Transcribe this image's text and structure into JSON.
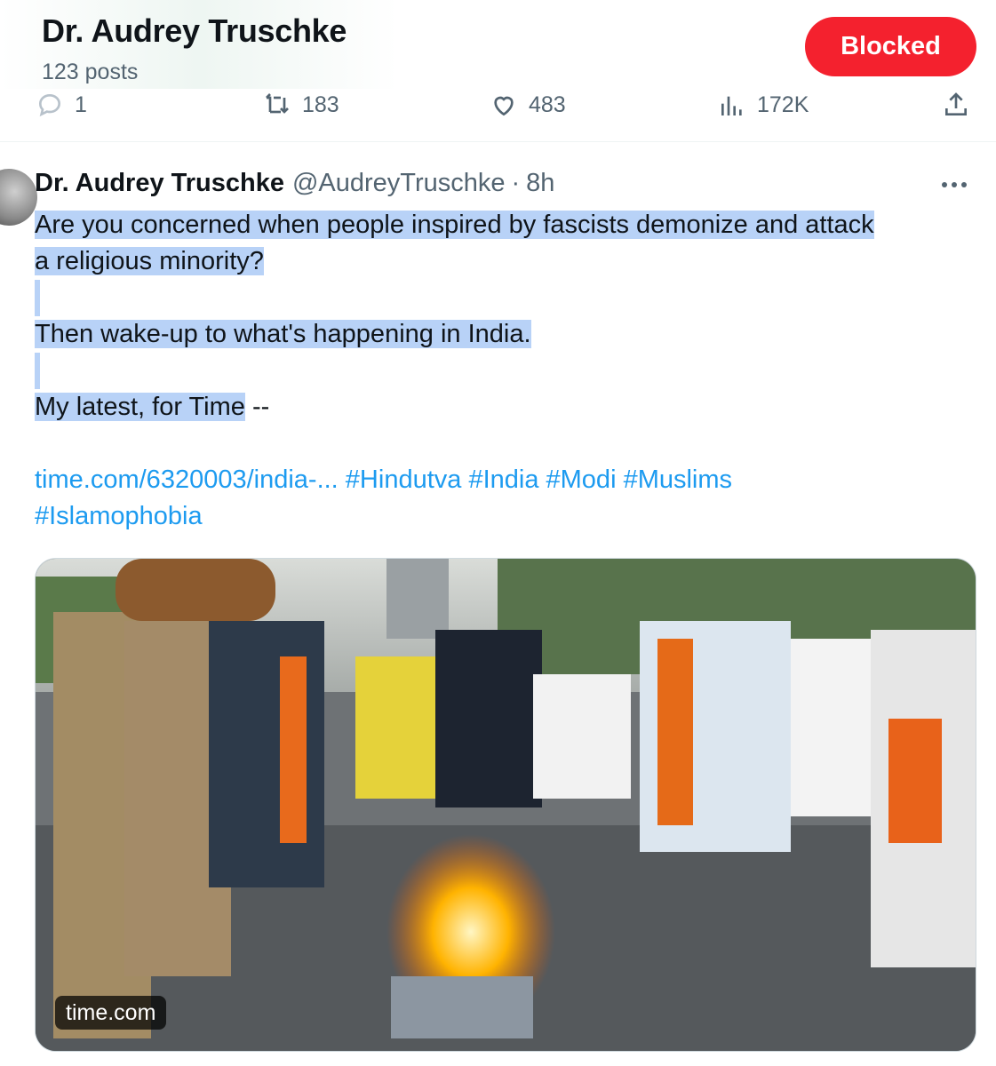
{
  "profile_header": {
    "name": "Dr. Audrey Truschke",
    "post_count": "123 posts",
    "block_button_label": "Blocked",
    "block_button_color": "#f4212e"
  },
  "previous_tweet_actions": {
    "replies": "1",
    "retweets": "183",
    "likes": "483",
    "views": "172K"
  },
  "tweet": {
    "author_name": "Dr. Audrey Truschke",
    "handle": "@AudreyTruschke",
    "separator": "·",
    "time": "8h",
    "text_lines": [
      "Are you concerned when people inspired by fascists demonize and attack",
      "a religious minority?",
      "Then wake-up to what's happening in India.",
      "My latest, for Time"
    ],
    "text_tail": " --",
    "link_text": "time.com/6320003/india-...",
    "hashtags_line1": " #Hindutva #India #Modi #Muslims",
    "hashtags_line2": "#Islamophobia",
    "media_source": "time.com",
    "highlight_color": "#b8d2f7",
    "link_color": "#1d9bf0"
  },
  "icons": [
    "reply-icon",
    "retweet-icon",
    "like-icon",
    "views-icon",
    "share-icon",
    "more-options-icon"
  ]
}
